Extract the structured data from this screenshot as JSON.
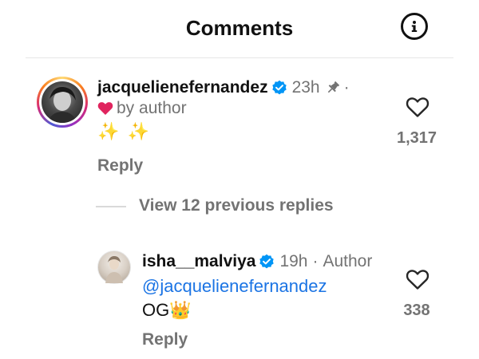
{
  "header": {
    "title": "Comments",
    "info_icon": "info-icon"
  },
  "comment": {
    "username": "jacquelienefernandez",
    "verified_icon": "verified-badge-icon",
    "time": "23h",
    "pin_icon": "pin-icon",
    "separator": "·",
    "liked_by": "by author",
    "text": "✨ ✨",
    "reply_label": "Reply",
    "like_count": "1,317",
    "heart_icon": "heart-outline-icon"
  },
  "view_replies": {
    "label": "View 12 previous replies"
  },
  "reply": {
    "username": "isha__malviya",
    "verified_icon": "verified-badge-icon",
    "time": "19h",
    "separator": "·",
    "author_tag": "Author",
    "mention": "@jacquelienefernandez",
    "text": "OG👑",
    "reply_label": "Reply",
    "like_count": "338",
    "heart_icon": "heart-outline-icon"
  },
  "colors": {
    "link": "#1b74e4",
    "verified": "#0095f6",
    "muted": "#737373",
    "heart_red": "#e0245e"
  }
}
